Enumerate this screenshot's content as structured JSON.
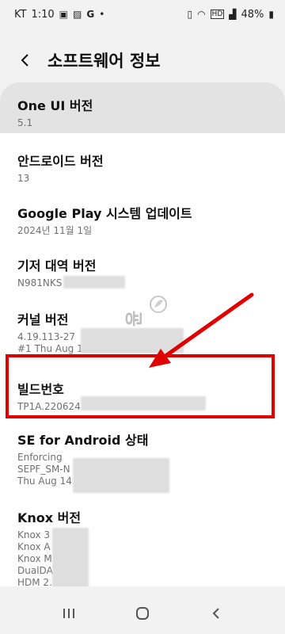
{
  "status_bar": {
    "carrier": "KT",
    "time": "1:10",
    "left_icons": [
      "notification-icon",
      "image-icon",
      "google-icon"
    ],
    "battery": "48%",
    "right_icons": [
      "vibrate-icon",
      "wifi-icon",
      "hd-icon",
      "signal-icon",
      "battery-icon"
    ]
  },
  "header": {
    "title": "소프트웨어 정보"
  },
  "items": [
    {
      "title": "One UI 버전",
      "values": [
        "5.1"
      ]
    },
    {
      "title": "안드로이드 버전",
      "values": [
        "13"
      ]
    },
    {
      "title": "Google Play 시스템 업데이트",
      "values": [
        "2024년 11월 1일"
      ]
    },
    {
      "title": "기저 대역 버전",
      "values": [
        "N981NKS"
      ]
    },
    {
      "title": "커널 버전",
      "values": [
        "4.19.113-27",
        "#1 Thu Aug 1"
      ]
    },
    {
      "title": "빌드번호",
      "values": [
        "TP1A.220624"
      ]
    },
    {
      "title": "SE for Android 상태",
      "values": [
        "Enforcing",
        "SEPF_SM-N",
        "Thu Aug 14"
      ]
    },
    {
      "title": "Knox 버전",
      "values": [
        "Knox 3",
        "Knox A",
        "Knox M",
        "DualDA",
        "HDM 2."
      ]
    }
  ],
  "watermark": "윤",
  "colors": {
    "highlight": "#e00000",
    "background": "#f2f2f2",
    "card": "#ffffff"
  }
}
